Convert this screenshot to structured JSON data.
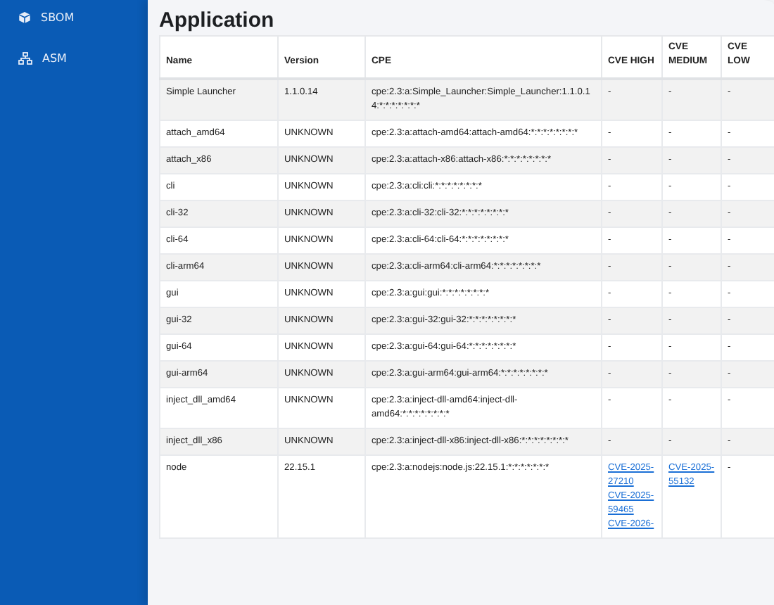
{
  "sidebar": {
    "items": [
      {
        "label": "SBOM",
        "selected": false
      },
      {
        "label": "ASM",
        "selected": false
      }
    ]
  },
  "title": "Application",
  "table": {
    "columns": [
      "Name",
      "Version",
      "CPE",
      "CVE HIGH",
      "CVE MEDIUM",
      "CVE LOW"
    ],
    "rows": [
      {
        "name": "Simple Launcher",
        "version": "1.1.0.14",
        "cpe": "cpe:2.3:a:Simple_Launcher:Simple_Launcher:1.1.0.14:*:*:*:*:*:*:*",
        "high": [
          "-"
        ],
        "medium": [
          "-"
        ],
        "low": [
          "-"
        ]
      },
      {
        "name": "attach_amd64",
        "version": "UNKNOWN",
        "cpe": "cpe:2.3:a:attach-amd64:attach-amd64:*:*:*:*:*:*:*:*",
        "high": [
          "-"
        ],
        "medium": [
          "-"
        ],
        "low": [
          "-"
        ]
      },
      {
        "name": "attach_x86",
        "version": "UNKNOWN",
        "cpe": "cpe:2.3:a:attach-x86:attach-x86:*:*:*:*:*:*:*:*",
        "high": [
          "-"
        ],
        "medium": [
          "-"
        ],
        "low": [
          "-"
        ]
      },
      {
        "name": "cli",
        "version": "UNKNOWN",
        "cpe": "cpe:2.3:a:cli:cli:*:*:*:*:*:*:*:*",
        "high": [
          "-"
        ],
        "medium": [
          "-"
        ],
        "low": [
          "-"
        ]
      },
      {
        "name": "cli-32",
        "version": "UNKNOWN",
        "cpe": "cpe:2.3:a:cli-32:cli-32:*:*:*:*:*:*:*:*",
        "high": [
          "-"
        ],
        "medium": [
          "-"
        ],
        "low": [
          "-"
        ]
      },
      {
        "name": "cli-64",
        "version": "UNKNOWN",
        "cpe": "cpe:2.3:a:cli-64:cli-64:*:*:*:*:*:*:*:*",
        "high": [
          "-"
        ],
        "medium": [
          "-"
        ],
        "low": [
          "-"
        ]
      },
      {
        "name": "cli-arm64",
        "version": "UNKNOWN",
        "cpe": "cpe:2.3:a:cli-arm64:cli-arm64:*:*:*:*:*:*:*:*",
        "high": [
          "-"
        ],
        "medium": [
          "-"
        ],
        "low": [
          "-"
        ]
      },
      {
        "name": "gui",
        "version": "UNKNOWN",
        "cpe": "cpe:2.3:a:gui:gui:*:*:*:*:*:*:*:*",
        "high": [
          "-"
        ],
        "medium": [
          "-"
        ],
        "low": [
          "-"
        ]
      },
      {
        "name": "gui-32",
        "version": "UNKNOWN",
        "cpe": "cpe:2.3:a:gui-32:gui-32:*:*:*:*:*:*:*:*",
        "high": [
          "-"
        ],
        "medium": [
          "-"
        ],
        "low": [
          "-"
        ]
      },
      {
        "name": "gui-64",
        "version": "UNKNOWN",
        "cpe": "cpe:2.3:a:gui-64:gui-64:*:*:*:*:*:*:*:*",
        "high": [
          "-"
        ],
        "medium": [
          "-"
        ],
        "low": [
          "-"
        ]
      },
      {
        "name": "gui-arm64",
        "version": "UNKNOWN",
        "cpe": "cpe:2.3:a:gui-arm64:gui-arm64:*:*:*:*:*:*:*:*",
        "high": [
          "-"
        ],
        "medium": [
          "-"
        ],
        "low": [
          "-"
        ]
      },
      {
        "name": "inject_dll_amd64",
        "version": "UNKNOWN",
        "cpe": "cpe:2.3:a:inject-dll-amd64:inject-dll-amd64:*:*:*:*:*:*:*:*",
        "high": [
          "-"
        ],
        "medium": [
          "-"
        ],
        "low": [
          "-"
        ]
      },
      {
        "name": "inject_dll_x86",
        "version": "UNKNOWN",
        "cpe": "cpe:2.3:a:inject-dll-x86:inject-dll-x86:*:*:*:*:*:*:*:*",
        "high": [
          "-"
        ],
        "medium": [
          "-"
        ],
        "low": [
          "-"
        ]
      },
      {
        "name": "node",
        "version": "22.15.1",
        "cpe": "cpe:2.3:a:nodejs:node.js:22.15.1:*:*:*:*:*:*:*",
        "high": [
          "CVE-2025-27210",
          "CVE-2025-59465",
          "CVE-2026-"
        ],
        "medium": [
          "CVE-2025-55132"
        ],
        "low": [
          "-"
        ]
      }
    ]
  }
}
